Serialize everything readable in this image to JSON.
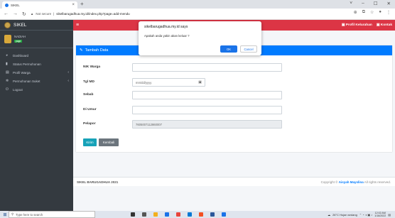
{
  "browser": {
    "tab_title": "SIKEL",
    "tab_close": "×",
    "new_tab": "+",
    "window_controls": [
      "˅",
      "–",
      "☐",
      "✕"
    ],
    "security": "Not secure",
    "url": "sikelbarugadhua.my.id/index.php?page=add-mendu"
  },
  "sidebar": {
    "brand": "SIKEL",
    "user_name": "NADIAH",
    "user_badge": "page",
    "items": [
      {
        "icon": "dashboard-icon",
        "label": "Dashboard",
        "arrow": ""
      },
      {
        "icon": "file-icon",
        "label": "Status Permohonan",
        "arrow": ""
      },
      {
        "icon": "table-icon",
        "label": "Profil Warga",
        "arrow": "‹"
      },
      {
        "icon": "cogs-icon",
        "label": "Permohonan Suket",
        "arrow": "‹"
      },
      {
        "icon": "logout-icon",
        "label": "Logout",
        "arrow": ""
      }
    ]
  },
  "topnav": {
    "menu": "≡",
    "links": [
      "Profil Kelurahan",
      "Kontak"
    ]
  },
  "card": {
    "title": "Tambah Data",
    "fields": [
      {
        "label": "NIK Warga",
        "value": ""
      },
      {
        "label": "Tgl MD",
        "value": "mm/dd/yyyy"
      },
      {
        "label": "Sebab",
        "value": ""
      },
      {
        "label": "Di Umur",
        "value": ""
      },
      {
        "label": "Pelapor",
        "value": "7605007112860007"
      }
    ],
    "submit": "Kirim",
    "back": "Kembali"
  },
  "footer": {
    "left": "SIKEL BARUGADHUA 2021",
    "right_prefix": "Copyright © ",
    "right_name": "Aisyah Mayslina",
    "right_suffix": " All rights reserved."
  },
  "dialog": {
    "title": "sikelbarugadhua.my.id says",
    "message": "Apakah anda yakin akan keluar ?",
    "ok": "OK",
    "cancel": "Cancel"
  },
  "taskbar": {
    "search_placeholder": "Type here to search",
    "weather": "26°C Hujan sedang",
    "time": "12:02 AM",
    "date": "1/16/2022",
    "app_colors": [
      "#333333",
      "#555555",
      "#f2b01e",
      "#1a73e8",
      "#e8453c",
      "#0078d4",
      "#f25022",
      "#2b579a",
      "#1a73e8"
    ]
  },
  "colors": {
    "sidebar": "#343a40",
    "topnav": "#dc3545",
    "card_header": "#007bff",
    "btn_submit": "#17a2b8",
    "btn_back": "#6c757d"
  }
}
